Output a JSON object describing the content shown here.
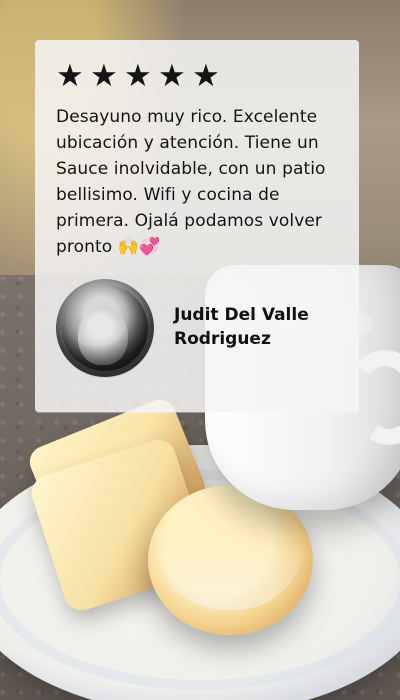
{
  "rating": {
    "stars": 5,
    "star_glyph": "★",
    "star_color": "#141414"
  },
  "review_text": "Desayuno muy rico. Excelente ubicación y atención. Tiene un Sauce inolvidable, con un patio bellisimo. Wifi y cocina de primera. Ojalá podamos volver pronto 🙌💞",
  "reviewer": {
    "name": "Judit Del Valle Rodriguez"
  },
  "colors": {
    "card_bg": "#f5f5f5",
    "text": "#141414"
  }
}
